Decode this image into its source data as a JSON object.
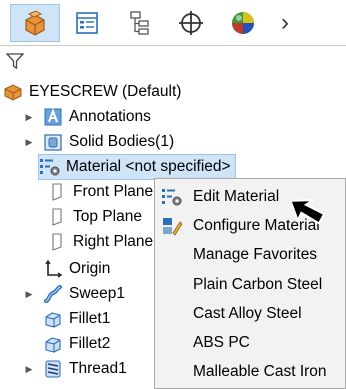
{
  "tabs": [
    {
      "name": "featuremanager",
      "active": true
    },
    {
      "name": "propertymanager",
      "active": false
    },
    {
      "name": "configurationmanager",
      "active": false
    },
    {
      "name": "dimxpertmanager",
      "active": false
    },
    {
      "name": "display-manager",
      "active": false
    }
  ],
  "tab_more_glyph": "›",
  "tree": {
    "root": "EYESCREW  (Default)",
    "items": [
      {
        "label": "Annotations",
        "icon": "annotations-icon",
        "expandable": true
      },
      {
        "label": "Solid Bodies(1)",
        "icon": "solid-bodies-icon",
        "expandable": true
      },
      {
        "label": "Material <not specified>",
        "icon": "material-icon",
        "expandable": false,
        "selected": true
      },
      {
        "label": "Front Plane",
        "icon": "plane-icon",
        "expandable": false
      },
      {
        "label": "Top Plane",
        "icon": "plane-icon",
        "expandable": false
      },
      {
        "label": "Right Plane",
        "icon": "plane-icon",
        "expandable": false
      },
      {
        "label": "Origin",
        "icon": "origin-icon",
        "expandable": false
      },
      {
        "label": "Sweep1",
        "icon": "sweep-icon",
        "expandable": true
      },
      {
        "label": "Fillet1",
        "icon": "fillet-icon",
        "expandable": false
      },
      {
        "label": "Fillet2",
        "icon": "fillet-icon",
        "expandable": false
      },
      {
        "label": "Thread1",
        "icon": "thread-icon",
        "expandable": true
      }
    ]
  },
  "context_menu": {
    "items": [
      {
        "label": "Edit Material",
        "icon": "edit-material-icon"
      },
      {
        "label": "Configure Material",
        "icon": "configure-material-icon"
      },
      {
        "label": "Manage Favorites",
        "icon": ""
      },
      {
        "label": "Plain Carbon Steel",
        "icon": ""
      },
      {
        "label": "Cast Alloy Steel",
        "icon": ""
      },
      {
        "label": "ABS PC",
        "icon": ""
      },
      {
        "label": "Malleable Cast Iron",
        "icon": ""
      }
    ]
  },
  "colors": {
    "selection_bg": "#cfe4f7",
    "selection_border": "#9ec4e6",
    "menu_bg": "#f2f2f2",
    "part_orange": "#e8923a",
    "icon_blue": "#2a6fb8"
  }
}
